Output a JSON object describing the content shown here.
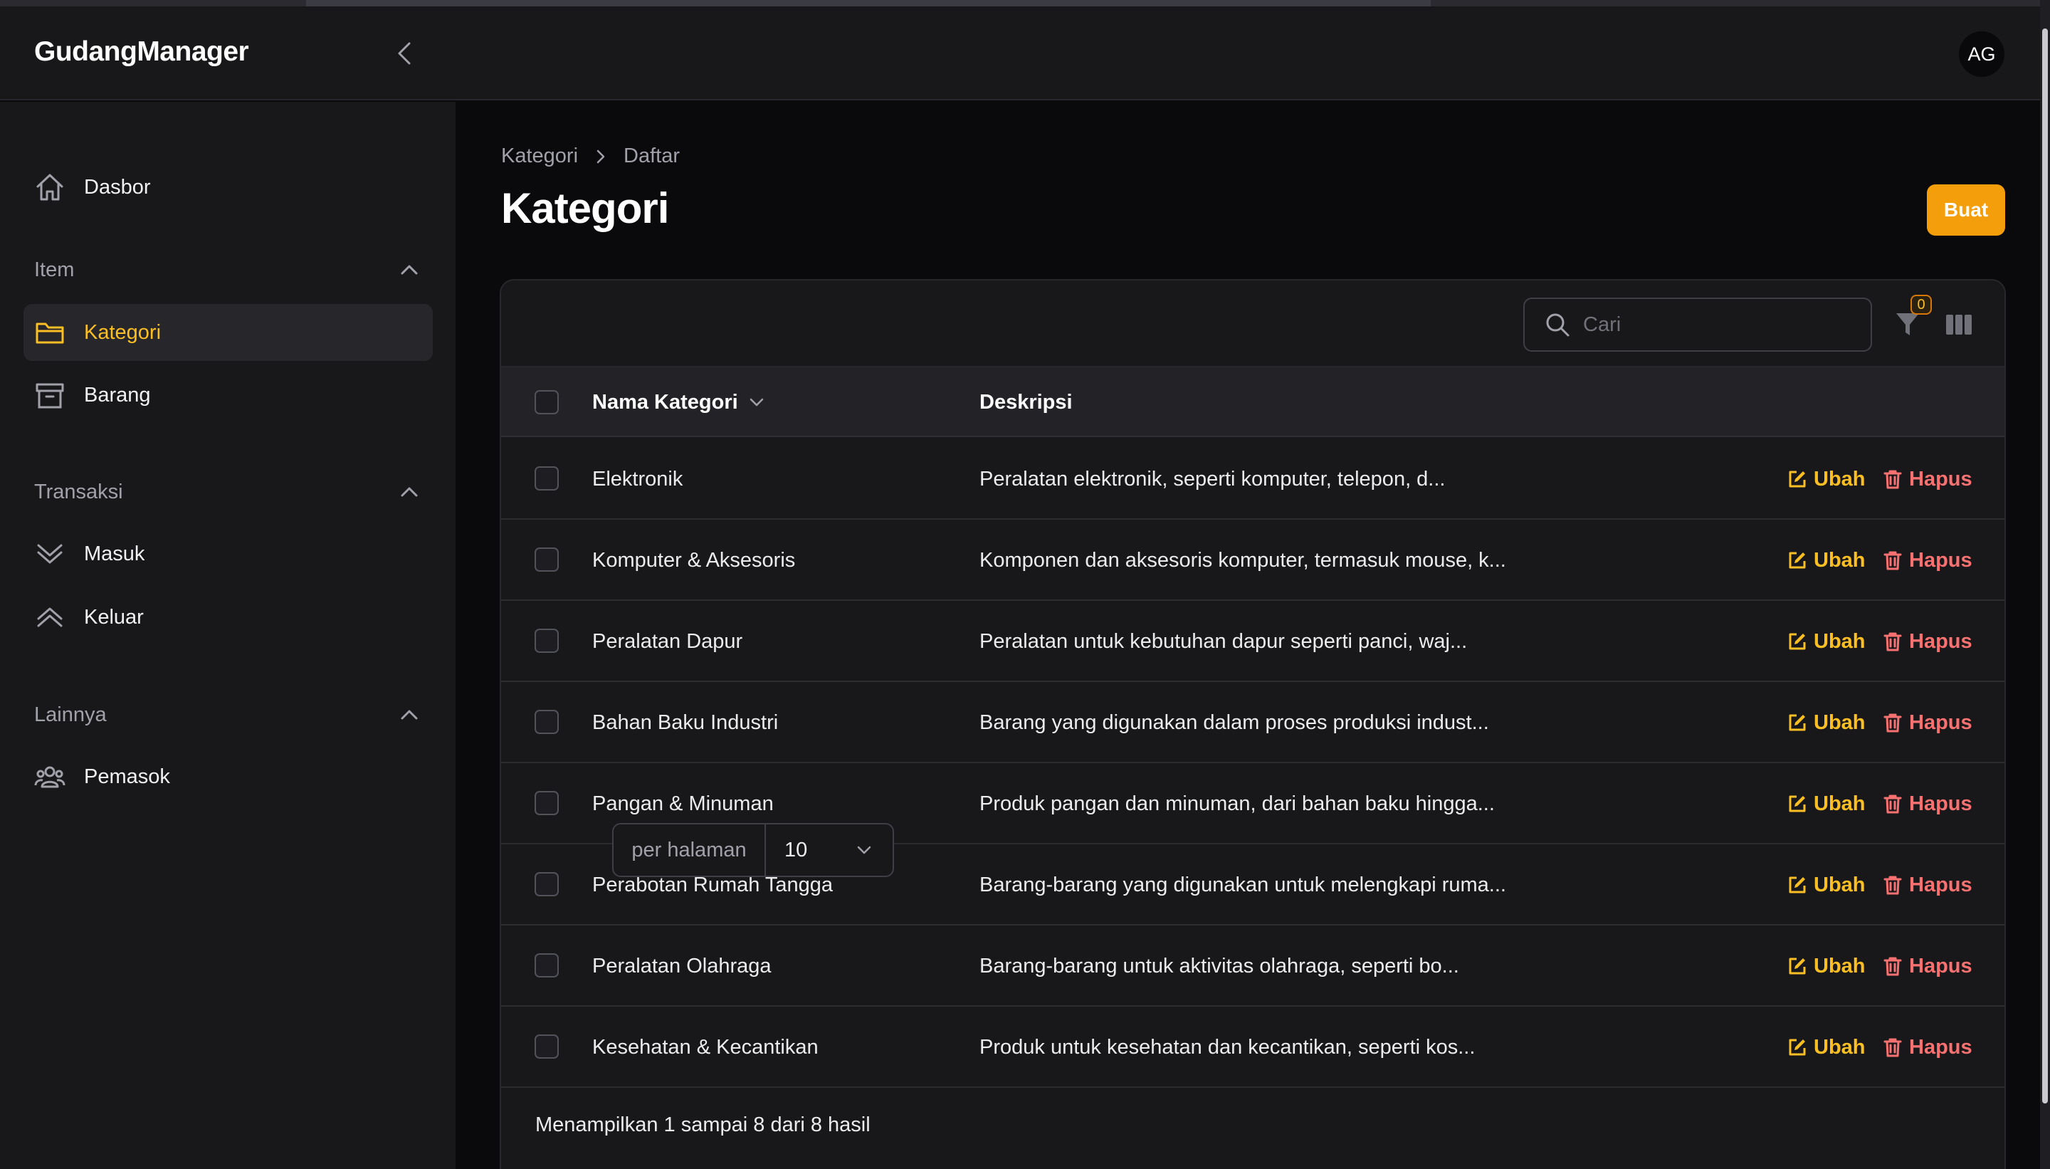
{
  "app": {
    "brand": "GudangManager",
    "user_initials": "AG"
  },
  "colors": {
    "accent": "#f59e0b",
    "accent_text": "#fbbf24",
    "danger": "#f87171",
    "surface": "#18181b",
    "background": "#0a0a0c"
  },
  "sidebar": {
    "top_item": {
      "label": "Dasbor",
      "icon": "home-icon"
    },
    "groups": [
      {
        "label": "Item",
        "items": [
          {
            "label": "Kategori",
            "icon": "folder-icon",
            "active": true
          },
          {
            "label": "Barang",
            "icon": "archive-box-icon",
            "active": false
          }
        ]
      },
      {
        "label": "Transaksi",
        "items": [
          {
            "label": "Masuk",
            "icon": "chevrons-down-icon",
            "active": false
          },
          {
            "label": "Keluar",
            "icon": "chevrons-up-icon",
            "active": false
          }
        ]
      },
      {
        "label": "Lainnya",
        "items": [
          {
            "label": "Pemasok",
            "icon": "user-group-icon",
            "active": false
          }
        ]
      }
    ]
  },
  "breadcrumb": [
    "Kategori",
    "Daftar"
  ],
  "page": {
    "title": "Kategori",
    "create_label": "Buat"
  },
  "table": {
    "search_placeholder": "Cari",
    "filter_count": "0",
    "columns": [
      "Nama Kategori",
      "Deskripsi"
    ],
    "edit_label": "Ubah",
    "delete_label": "Hapus",
    "rows": [
      {
        "name": "Elektronik",
        "description": "Peralatan elektronik, seperti komputer, telepon, d..."
      },
      {
        "name": "Komputer & Aksesoris",
        "description": "Komponen dan aksesoris komputer, termasuk mouse, k..."
      },
      {
        "name": "Peralatan Dapur",
        "description": "Peralatan untuk kebutuhan dapur seperti panci, waj..."
      },
      {
        "name": "Bahan Baku Industri",
        "description": "Barang yang digunakan dalam proses produksi indust..."
      },
      {
        "name": "Pangan & Minuman",
        "description": "Produk pangan dan minuman, dari bahan baku hingga..."
      },
      {
        "name": "Perabotan Rumah Tangga",
        "description": "Barang-barang yang digunakan untuk melengkapi ruma..."
      },
      {
        "name": "Peralatan Olahraga",
        "description": "Barang-barang untuk aktivitas olahraga, seperti bo..."
      },
      {
        "name": "Kesehatan & Kecantikan",
        "description": "Produk untuk kesehatan dan kecantikan, seperti kos..."
      }
    ],
    "footer": {
      "result_text": "Menampilkan 1 sampai 8 dari 8 hasil",
      "per_page_label": "per halaman",
      "per_page_value": "10"
    }
  }
}
